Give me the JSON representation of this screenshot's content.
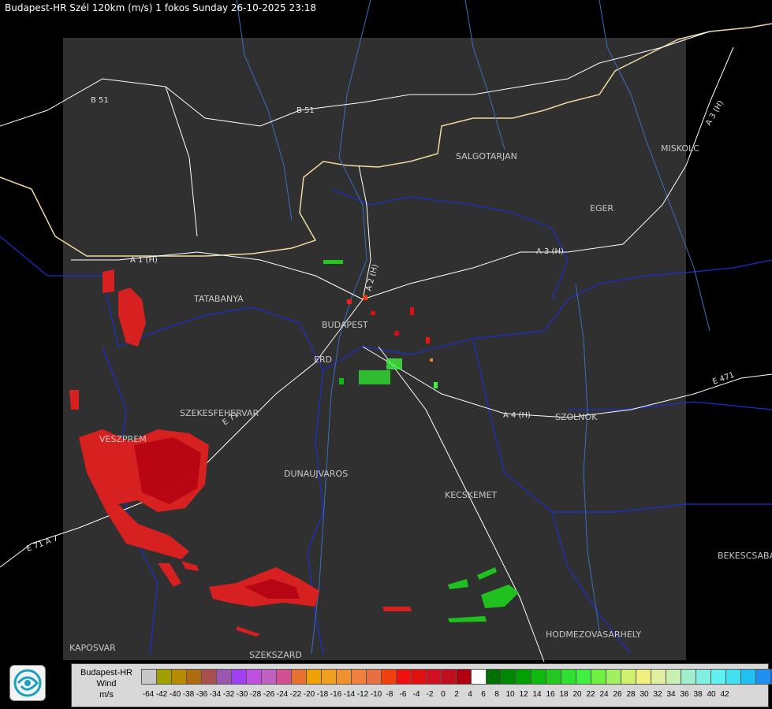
{
  "header": {
    "title": "Budapest-HR Szél 120km (m/s) 1 fokos Sunday 26-10-2025 23:18"
  },
  "map": {
    "cities": [
      "SALGOTARJAN",
      "MISKOLC",
      "EGER",
      "TATABANYA",
      "BUDAPEST",
      "ERD",
      "SZEKESFEHERVAR",
      "VESZPREM",
      "DUNAUJVAROS",
      "KECSKEMET",
      "SZOLNOK",
      "BEKESCSABA",
      "HODMEZOVASARHELY",
      "KAPOSVAR",
      "SZEKSZARD"
    ],
    "roads": [
      "B 51",
      "B 51",
      "A 3 (H)",
      "A 3 (H)",
      "A 2 (H)",
      "A 1 (H)",
      "A 4 (H)",
      "E 471",
      "E 71",
      "E 71 A 7"
    ],
    "colors": {
      "frame": "#303030",
      "border": "#1a2fd0",
      "rivers": "#3a6fbf",
      "roads": "#ffffff"
    }
  },
  "legend": {
    "title_line1": "Budapest-HR",
    "title_line2": "Wind",
    "title_line3": "m/s",
    "labels": [
      "-64",
      "-42",
      "-40",
      "-38",
      "-36",
      "-34",
      "-32",
      "-30",
      "-28",
      "-26",
      "-24",
      "-22",
      "-20",
      "-18",
      "-16",
      "-14",
      "-12",
      "-10",
      "-8",
      "-6",
      "-4",
      "-2",
      "0",
      "2",
      "4",
      "6",
      "8",
      "10",
      "12",
      "14",
      "16",
      "18",
      "20",
      "22",
      "24",
      "26",
      "28",
      "30",
      "32",
      "34",
      "36",
      "38",
      "40",
      "42"
    ],
    "colors": [
      "#c8c8c8",
      "#a0a000",
      "#b88a00",
      "#b06a10",
      "#a85050",
      "#9858b0",
      "#a040f0",
      "#c050e0",
      "#c060c0",
      "#d05090",
      "#e87030",
      "#f0a000",
      "#f0a020",
      "#f09030",
      "#f08040",
      "#e87040",
      "#f04010",
      "#f01010",
      "#e01010",
      "#d01020",
      "#c01020",
      "#b00010",
      "#ffffff",
      "#007000",
      "#008800",
      "#00a000",
      "#10b810",
      "#20c820",
      "#30e030",
      "#40f040",
      "#70f040",
      "#a0f060",
      "#d0f070",
      "#f0f080",
      "#e0f0a0",
      "#c8f0b0",
      "#a0f0d0",
      "#80f0e0",
      "#60f0f0",
      "#40e0f0",
      "#20c0f0",
      "#2090f0",
      "#1060f0",
      "#0020f0"
    ]
  }
}
